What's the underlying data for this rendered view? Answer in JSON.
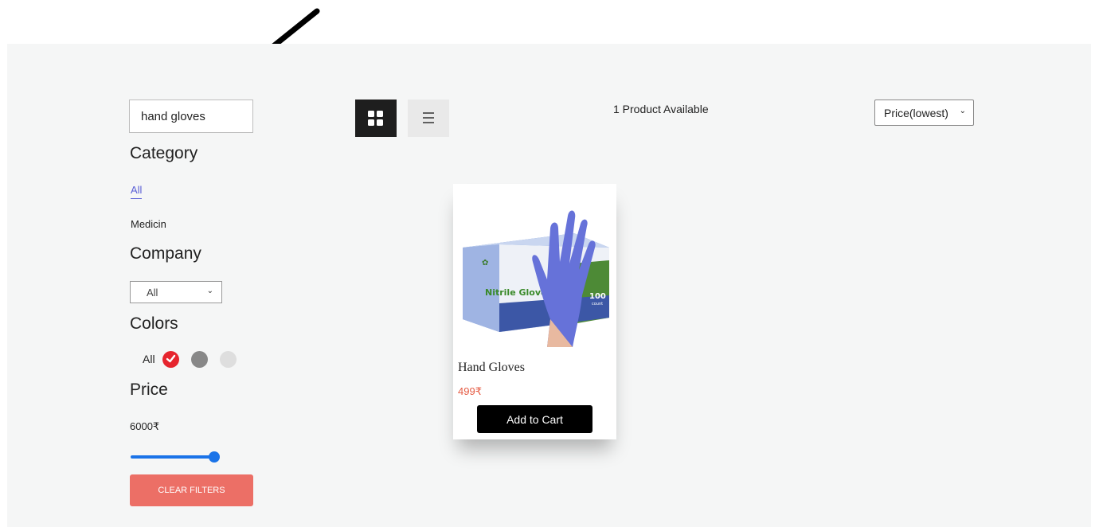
{
  "filters": {
    "search": {
      "value": "hand gloves",
      "placeholder": "Search"
    },
    "category": {
      "heading": "Category",
      "items": [
        {
          "label": "All",
          "active": true
        },
        {
          "label": "Medicin",
          "active": false
        }
      ]
    },
    "company": {
      "heading": "Company",
      "selected": "All"
    },
    "colors": {
      "heading": "Colors",
      "all_label": "All",
      "swatches": [
        {
          "color": "#e6252e",
          "selected": true
        },
        {
          "color": "#888888",
          "selected": false
        },
        {
          "color": "#dedede",
          "selected": false
        }
      ]
    },
    "price": {
      "heading": "Price",
      "value_text": "6000₹",
      "slider_fraction": 1.0
    },
    "clear_label": "CLEAR FILTERS"
  },
  "toolbar": {
    "grid_icon": "grid-view-icon",
    "list_icon": "list-view-icon",
    "count_text": "1 Product Available",
    "sort_selected": "Price(lowest)"
  },
  "products": [
    {
      "name": "Hand Gloves",
      "price": "499₹",
      "cart_label": "Add to Cart",
      "image": {
        "box_label": "Nitrile Glove",
        "count_badge": "100",
        "count_sub": "count"
      }
    }
  ],
  "colors": {
    "accent": "#5a5fd6",
    "clear_button": "#ec6f66",
    "slider": "#1a73e8",
    "price": "#e55c44"
  }
}
